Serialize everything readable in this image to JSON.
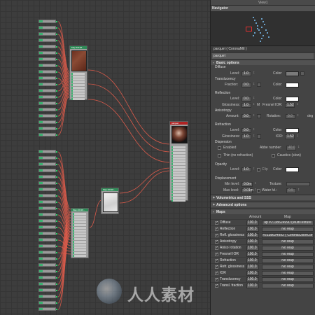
{
  "panel": {
    "top_label": "View1",
    "navigator_title": "Navigator",
    "material_title": "parquet  ( CoronaMtl )",
    "material_name": "parquet"
  },
  "basic": {
    "header": "Basic options",
    "toggle": "-",
    "diffuse": {
      "title": "Diffuse",
      "level_label": "Level:",
      "level": "1.0",
      "color_label": "Color:",
      "color": "#7a7a7a"
    },
    "translucency": {
      "title": "Translucency",
      "fraction_label": "Fraction:",
      "fraction": "0.0",
      "color_label": "Color:",
      "color": "#ffffff"
    },
    "reflection": {
      "title": "Reflection",
      "level_label": "Level:",
      "level": "0.0",
      "color_label": "Color:",
      "color": "#ffffff",
      "gloss_label": "Glossiness:",
      "gloss": "1.0",
      "gloss_map": "M",
      "fresnel_label": "Fresnel IOR:",
      "fresnel": "1.52",
      "aniso_title": "Anisotropy",
      "amount_label": "Amount:",
      "amount": "0.0",
      "rotation_label": "Rotation:",
      "rotation": "0.0",
      "rotation_unit": "deg"
    },
    "refraction": {
      "title": "Refraction",
      "level_label": "Level:",
      "level": "0.0",
      "color_label": "Color:",
      "color": "#ffffff",
      "gloss_label": "Glossiness:",
      "gloss": "1.0",
      "ior_label": "IOR:",
      "ior": "1.52",
      "dispersion_title": "Dispersion",
      "enabled_label": "Enabled",
      "abbe_label": "Abbe number:",
      "abbe": "40.0",
      "thin_label": "Thin (no refraction)",
      "caustics_label": "Caustics (slow)"
    },
    "opacity": {
      "title": "Opacity",
      "level_label": "Level:",
      "level": "1.0",
      "clip_label": "Clip",
      "color_label": "Color:",
      "color": "#ffffff"
    },
    "displacement": {
      "title": "Displacement",
      "min_label": "Min level:",
      "min": "0.0m",
      "texture_label": "Texture:",
      "max_label": "Max level:",
      "max": "0.01m",
      "water_label": "Water lvl.:",
      "water": "0.5"
    }
  },
  "rollouts": {
    "volumetrics": "Volumetrics and SSS",
    "advanced": "Advanced options",
    "maps": "Maps",
    "collapsed_toggle": "+",
    "expanded_toggle": "-",
    "col_amount": "Amount",
    "col_map": "Map"
  },
  "maps": [
    {
      "name": "Diffuse",
      "amount": "100.0",
      "map": "ap #2138624990 (MultiTexture"
    },
    {
      "name": "Reflection",
      "amount": "100.0",
      "map": "No Map"
    },
    {
      "name": "Refl. glossiness",
      "amount": "100.0",
      "map": "#2138624992  ( CoronaColorCor"
    },
    {
      "name": "Anisotropy",
      "amount": "100.0",
      "map": "No Map"
    },
    {
      "name": "Aniso rotation",
      "amount": "100.0",
      "map": "No Map"
    },
    {
      "name": "Fresnel IOR",
      "amount": "100.0",
      "map": "No Map"
    },
    {
      "name": "Refraction",
      "amount": "100.0",
      "map": "No Map"
    },
    {
      "name": "Refr. glossiness",
      "amount": "100.0",
      "map": "No Map"
    },
    {
      "name": "IOR",
      "amount": "100.0",
      "map": "No Map"
    },
    {
      "name": "Translucency",
      "amount": "100.0",
      "map": "No Map"
    },
    {
      "name": "Transl. fraction",
      "amount": "100.0",
      "map": "No Map"
    }
  ],
  "nodes": {
    "node_a_title": "Map #2138...",
    "node_b_title": "Map #2138...",
    "node_c_title": "Map #2138...",
    "material_node_title": "parquet"
  },
  "watermark": "人人素材",
  "colors": {
    "wire": "#d85a4a",
    "node_green": "#3cb371",
    "panel_bg": "#444444"
  }
}
